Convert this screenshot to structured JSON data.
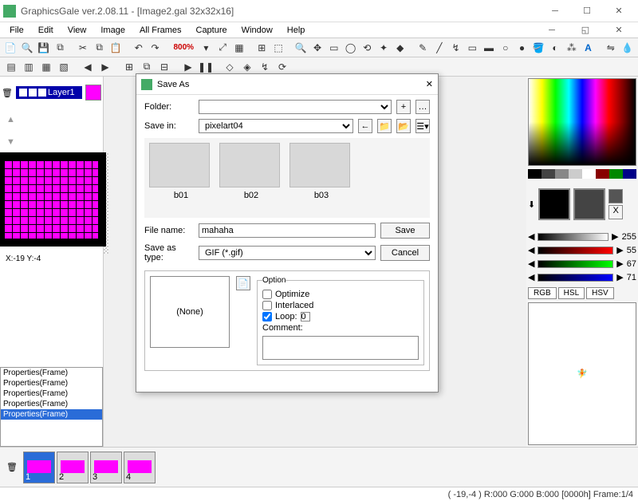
{
  "title": "GraphicsGale ver.2.08.11 - [Image2.gal 32x32x16]",
  "menu": [
    "File",
    "Edit",
    "View",
    "Image",
    "All Frames",
    "Capture",
    "Window",
    "Help"
  ],
  "zoom": "800%",
  "layer_name": "Layer1",
  "coords": "X:-19 Y:-4",
  "props": [
    "Properties(Frame)",
    "Properties(Frame)",
    "Properties(Frame)",
    "Properties(Frame)",
    "Properties(Frame)"
  ],
  "slider_vals": [
    "255",
    "55",
    "67",
    "71"
  ],
  "color_tabs": [
    "RGB",
    "HSL",
    "HSV"
  ],
  "frames": [
    "1",
    "2",
    "3",
    "4"
  ],
  "status": "( -19,-4 ) R:000 G:000 B:000  [0000h]  Frame:1/4",
  "dialog": {
    "title": "Save As",
    "folder_lbl": "Folder:",
    "savein_lbl": "Save in:",
    "savein_val": "pixelart04",
    "thumbs": [
      "b01",
      "b02",
      "b03"
    ],
    "filename_lbl": "File name:",
    "filename_val": "mahaha",
    "type_lbl": "Save as type:",
    "type_val": "GIF (*.gif)",
    "save_btn": "Save",
    "cancel_btn": "Cancel",
    "none": "(None)",
    "option_legend": "Option",
    "opt_optimize": "Optimize",
    "opt_interlaced": "Interlaced",
    "opt_loop": "Loop:",
    "opt_loop_val": "0",
    "opt_comment": "Comment:"
  }
}
